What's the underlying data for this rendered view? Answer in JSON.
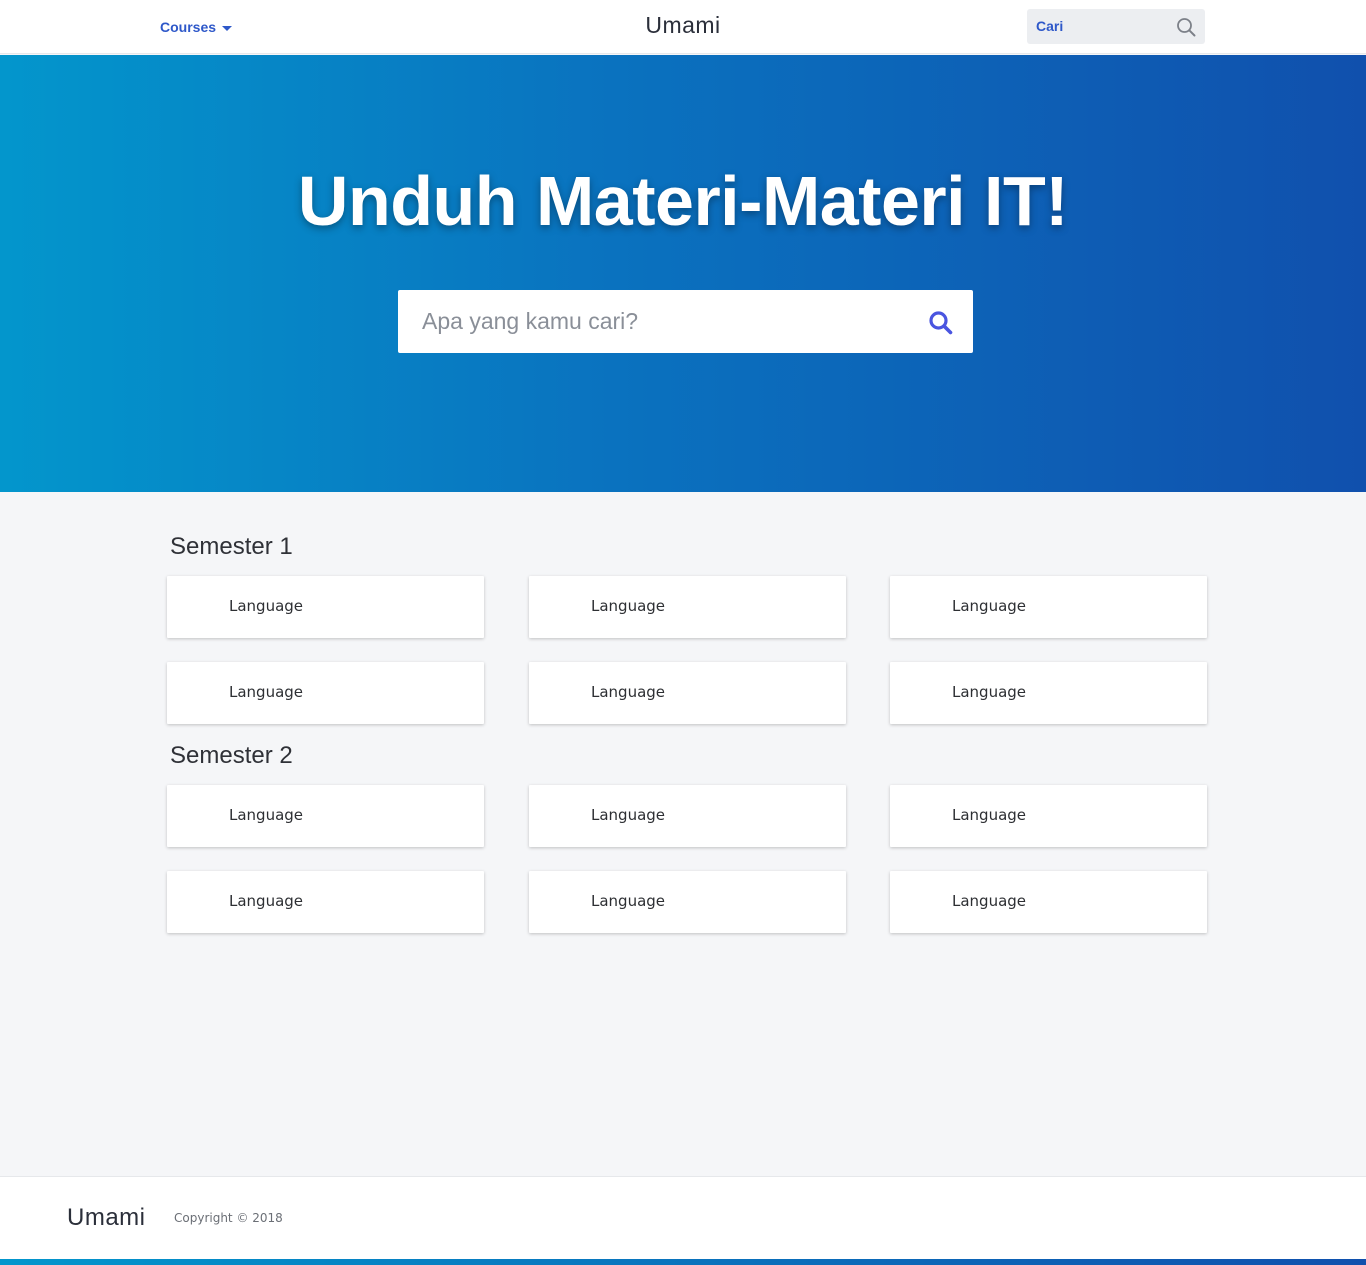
{
  "nav": {
    "courses_label": "Courses",
    "brand": "Umami",
    "search_label": "Cari"
  },
  "hero": {
    "title": "Unduh Materi-Materi IT!",
    "search_placeholder": "Apa yang kamu cari?"
  },
  "sections": [
    {
      "title": "Semester 1",
      "cards": [
        "Language",
        "Language",
        "Language",
        "Language",
        "Language",
        "Language"
      ]
    },
    {
      "title": "Semester 2",
      "cards": [
        "Language",
        "Language",
        "Language",
        "Language",
        "Language",
        "Language"
      ]
    }
  ],
  "footer": {
    "brand": "Umami",
    "copyright": "Copyright © 2018"
  },
  "colors": {
    "accent": "#2e58c9",
    "hero_gradient_start": "#0396cc",
    "hero_gradient_end": "#1050ad",
    "search_icon": "#4a55e0"
  },
  "icons": {
    "top_search": "search-icon",
    "hero_search": "search-icon",
    "courses_dropdown": "caret-down-icon"
  }
}
